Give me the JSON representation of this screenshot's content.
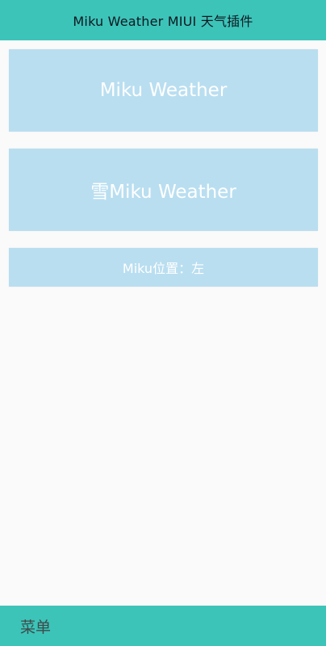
{
  "header": {
    "title": "Miku Weather MIUI 天气插件"
  },
  "cards": [
    {
      "label": "Miku Weather"
    },
    {
      "label": "雪Miku Weather"
    },
    {
      "label": "Miku位置：左"
    }
  ],
  "footer": {
    "menu_label": "菜单"
  },
  "colors": {
    "accent": "#3cc4b9",
    "card": "#b9def0",
    "background": "#fafafa"
  }
}
